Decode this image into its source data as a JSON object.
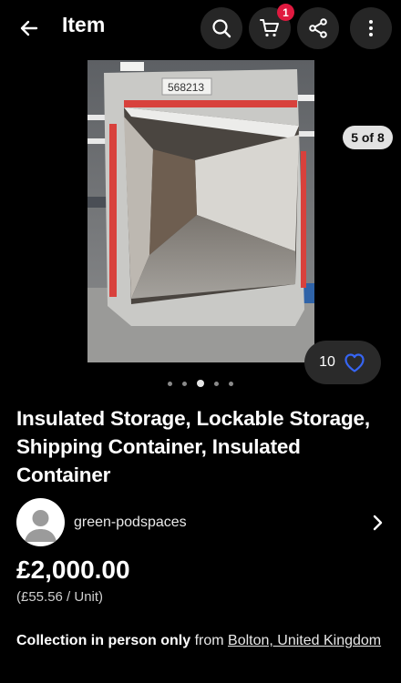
{
  "header": {
    "title": "Item",
    "cart_count": "1"
  },
  "gallery": {
    "counter": "5 of 8",
    "watch_count": "10",
    "dot_count": 5,
    "active_dot": 2,
    "photo_label": "568213"
  },
  "listing": {
    "title": "Insulated Storage, Lockable Storage, Shipping Container, Insulated Container",
    "seller_name": "green-podspaces",
    "price": "£2,000.00",
    "unit_price": "(£55.56 / Unit)",
    "collection_label": "Collection in person only",
    "collection_from": " from ",
    "collection_location": "Bolton, United Kingdom"
  },
  "colors": {
    "background": "#000000",
    "button_bg": "#262626",
    "badge": "#e0193f",
    "heart": "#3665f3"
  },
  "icons": [
    "back-arrow-icon",
    "search-icon",
    "cart-icon",
    "share-icon",
    "more-vertical-icon",
    "heart-icon",
    "chevron-right-icon",
    "avatar-placeholder-icon"
  ]
}
